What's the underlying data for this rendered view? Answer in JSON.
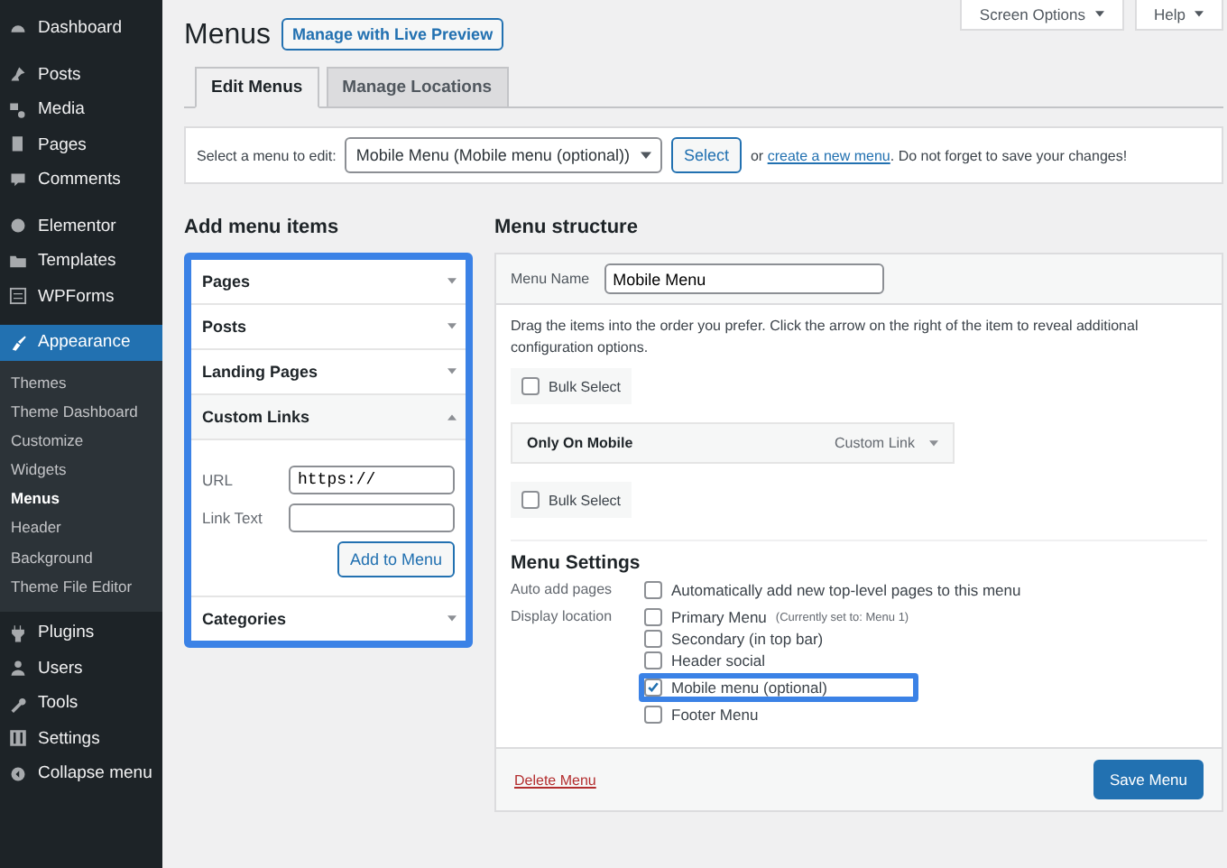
{
  "sidebar": {
    "groups": [
      [
        {
          "label": "Dashboard",
          "selected": false
        }
      ],
      [
        {
          "label": "Posts",
          "selected": false
        },
        {
          "label": "Media",
          "selected": false
        },
        {
          "label": "Pages",
          "selected": false
        },
        {
          "label": "Comments",
          "selected": false
        }
      ],
      [
        {
          "label": "Elementor",
          "selected": false
        },
        {
          "label": "Templates",
          "selected": false
        },
        {
          "label": "WPForms",
          "selected": false
        }
      ],
      [
        {
          "label": "Appearance",
          "selected": true,
          "children": [
            {
              "label": "Themes",
              "selected": false
            },
            {
              "label": "Theme Dashboard",
              "selected": false
            },
            {
              "label": "Customize",
              "selected": false
            },
            {
              "label": "Widgets",
              "selected": false
            },
            {
              "label": "Menus",
              "selected": true
            },
            {
              "label": "Header",
              "selected": false
            },
            {
              "label": "Background",
              "selected": false
            },
            {
              "label": "Theme File Editor",
              "selected": false
            }
          ]
        },
        {
          "label": "Plugins",
          "selected": false
        },
        {
          "label": "Users",
          "selected": false
        },
        {
          "label": "Tools",
          "selected": false
        },
        {
          "label": "Settings",
          "selected": false
        },
        {
          "label": "Collapse menu",
          "selected": false
        }
      ]
    ]
  },
  "header": {
    "title": "Menus",
    "live_preview_button": "Manage with Live Preview",
    "screen_options": "Screen Options",
    "help": "Help"
  },
  "tabs": [
    {
      "label": "Edit Menus",
      "selected": true
    },
    {
      "label": "Manage Locations",
      "selected": false
    }
  ],
  "select_bar": {
    "label": "Select a menu to edit:",
    "dropdown_value": "Mobile Menu (Mobile menu (optional))",
    "button": "Select",
    "note_before": "or",
    "link": "create a new menu",
    "note_after": ". Do not forget to save your changes!"
  },
  "add_menu_items": {
    "title": "Add menu items",
    "highlighted": true,
    "sections": [
      {
        "label": "Pages",
        "expanded": false
      },
      {
        "label": "Posts",
        "expanded": false
      },
      {
        "label": "Landing Pages",
        "expanded": false
      },
      {
        "label": "Custom Links",
        "expanded": true,
        "url_label": "URL",
        "url_value": "https://",
        "link_text_label": "Link Text",
        "button": "Add to Menu"
      },
      {
        "label": "Categories",
        "expanded": false
      }
    ]
  },
  "menu_structure": {
    "title": "Menu structure",
    "menu_name_label": "Menu Name",
    "menu_name_value": "Mobile Menu",
    "instructions": "Drag the items into the order you prefer. Click the arrow on the right of the item to reveal additional configuration options.",
    "bulk_select_top": {
      "label": "Bulk Select",
      "checked": false
    },
    "items": [
      {
        "title": "Only On Mobile",
        "type": "Custom Link"
      }
    ],
    "bulk_select_bottom": {
      "label": "Bulk Select",
      "checked": false
    },
    "settings_title": "Menu Settings",
    "auto_add": {
      "label": "Auto add pages",
      "options": [
        {
          "label": "Automatically add new top-level pages to this menu",
          "checked": false
        }
      ]
    },
    "display_location": {
      "label": "Display location",
      "options": [
        {
          "label": "Primary Menu",
          "note": "(Currently set to: Menu 1)",
          "checked": false
        },
        {
          "label": "Secondary (in top bar)",
          "checked": false
        },
        {
          "label": "Header social",
          "checked": false
        },
        {
          "label": "Mobile menu (optional)",
          "checked": true,
          "highlighted": true
        },
        {
          "label": "Footer Menu",
          "checked": false
        }
      ]
    },
    "delete_link": "Delete Menu",
    "save_button": "Save Menu"
  }
}
